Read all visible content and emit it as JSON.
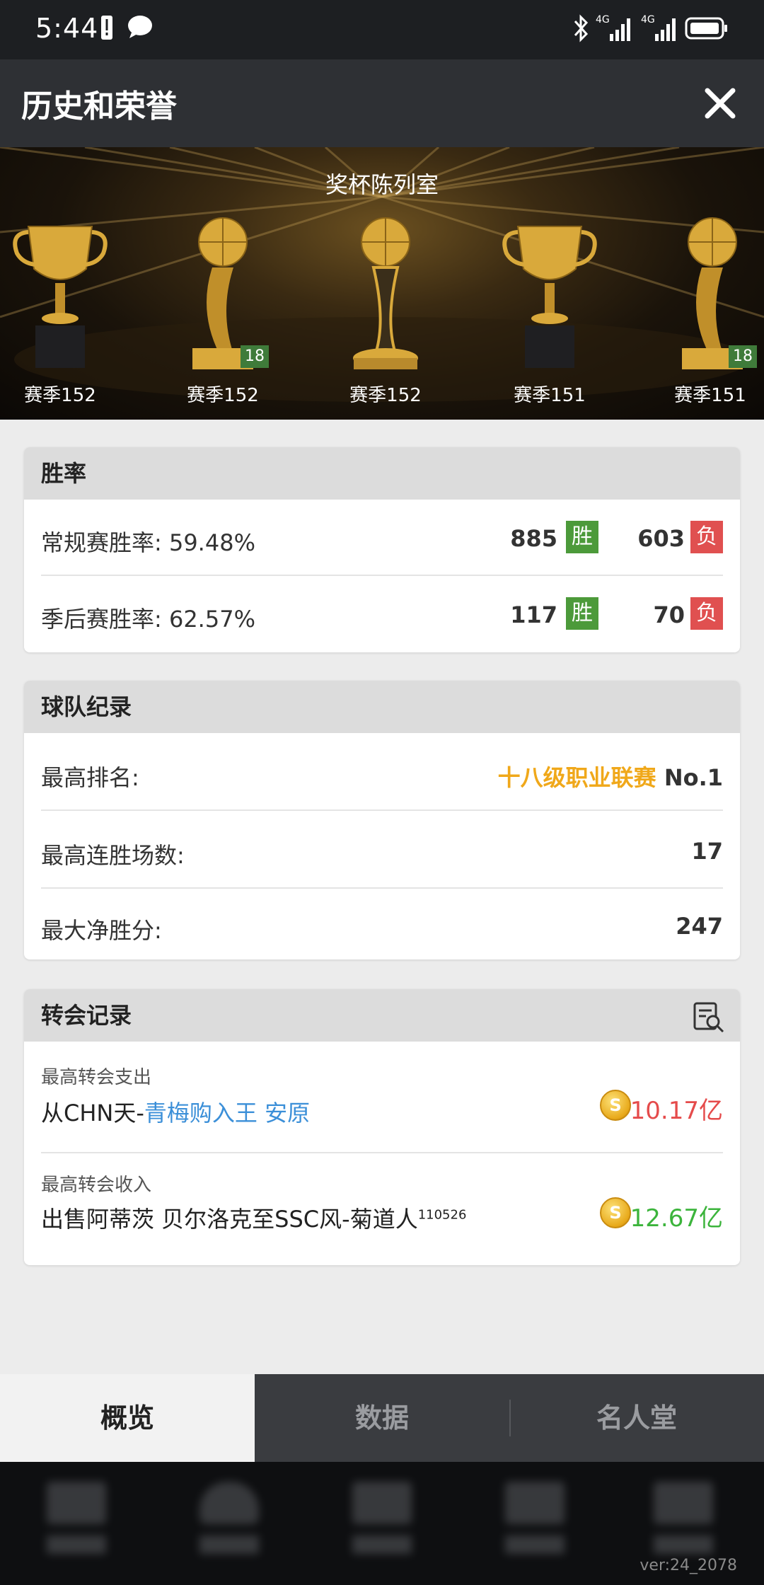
{
  "status_bar": {
    "time": "5:44",
    "network1": "4G",
    "network2": "4G"
  },
  "header": {
    "title": "历史和荣誉"
  },
  "banner": {
    "title": "奖杯陈列室",
    "trophies": [
      {
        "label": "赛季152",
        "type": "cup",
        "badge": ""
      },
      {
        "label": "赛季152",
        "type": "ball",
        "badge": "18"
      },
      {
        "label": "赛季152",
        "type": "ball-tall",
        "badge": ""
      },
      {
        "label": "赛季151",
        "type": "cup",
        "badge": ""
      },
      {
        "label": "赛季151",
        "type": "ball",
        "badge": "18"
      }
    ]
  },
  "win_rate": {
    "title": "胜率",
    "rows": [
      {
        "label": "常规赛胜率:  59.48%",
        "wins": "885",
        "win_tag": "胜",
        "losses": "603",
        "loss_tag": "负"
      },
      {
        "label": "季后赛胜率:  62.57%",
        "wins": "117",
        "win_tag": "胜",
        "losses": "70",
        "loss_tag": "负"
      }
    ]
  },
  "team_record": {
    "title": "球队纪录",
    "rows": [
      {
        "label": "最高排名:",
        "league": "十八级职业联赛",
        "value": "No.1"
      },
      {
        "label": "最高连胜场数:",
        "value": "17"
      },
      {
        "label": "最大净胜分:",
        "value": "247"
      }
    ]
  },
  "transfer_record": {
    "title": "转会记录",
    "rows": [
      {
        "label": "最高转会支出",
        "prefix": "从CHN天-",
        "link": "青梅购入王 安原",
        "suffix": "",
        "sup": "",
        "coin": "S",
        "amount": "10.17亿"
      },
      {
        "label": "最高转会收入",
        "prefix": "出售阿蒂茨 贝尔洛克至SSC风-菊道人",
        "link": "",
        "suffix": "",
        "sup": "110526",
        "coin": "S",
        "amount": "12.67亿"
      }
    ]
  },
  "tabs": [
    "概览",
    "数据",
    "名人堂"
  ],
  "active_tab": 0,
  "version": "ver:24_2078",
  "colors": {
    "win": "#4c9a3a",
    "lose": "#e05050",
    "gold": "#f0a81a",
    "link": "#3b8fd8",
    "expense": "#e54b4b",
    "income": "#3cb43c"
  }
}
